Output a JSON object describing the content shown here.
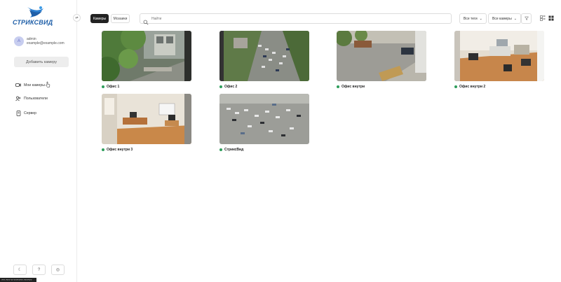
{
  "brand": {
    "name": "СТРИКСВИД"
  },
  "user": {
    "initial": "A",
    "name": "admin",
    "email": "example@example.com"
  },
  "sidebar": {
    "add_camera": "Добавить камеру",
    "items": [
      {
        "label": "Мои камеры",
        "icon": "camera-icon"
      },
      {
        "label": "Пользователи",
        "icon": "users-icon"
      },
      {
        "label": "Сервер",
        "icon": "server-icon"
      }
    ],
    "bottom": [
      {
        "icon": "moon-icon",
        "glyph": "☾"
      },
      {
        "icon": "help-icon",
        "glyph": "?"
      },
      {
        "icon": "support-icon",
        "glyph": "◎"
      }
    ],
    "status": "??? ???? ?? ???????? ???????"
  },
  "toolbar": {
    "tabs": [
      "Камеры",
      "Мозаики"
    ],
    "search_placeholder": "Найти",
    "tags_dropdown": "Все теги",
    "cameras_dropdown": "Все камеры"
  },
  "cameras": [
    {
      "name": "Офис 1",
      "status": "online",
      "scene": "yard-trees"
    },
    {
      "name": "Офис 2",
      "status": "online",
      "scene": "parking-top"
    },
    {
      "name": "Офис внутри",
      "status": "online",
      "scene": "courtyard"
    },
    {
      "name": "Офис внутри 2",
      "status": "online",
      "scene": "office-wide"
    },
    {
      "name": "Офис внутри 3",
      "status": "online",
      "scene": "office-desk"
    },
    {
      "name": "СтриксВид",
      "status": "online",
      "scene": "parking-lot"
    }
  ],
  "colors": {
    "accent": "#222222",
    "online": "#2e9e5b",
    "brand": "#1f5fa8"
  }
}
